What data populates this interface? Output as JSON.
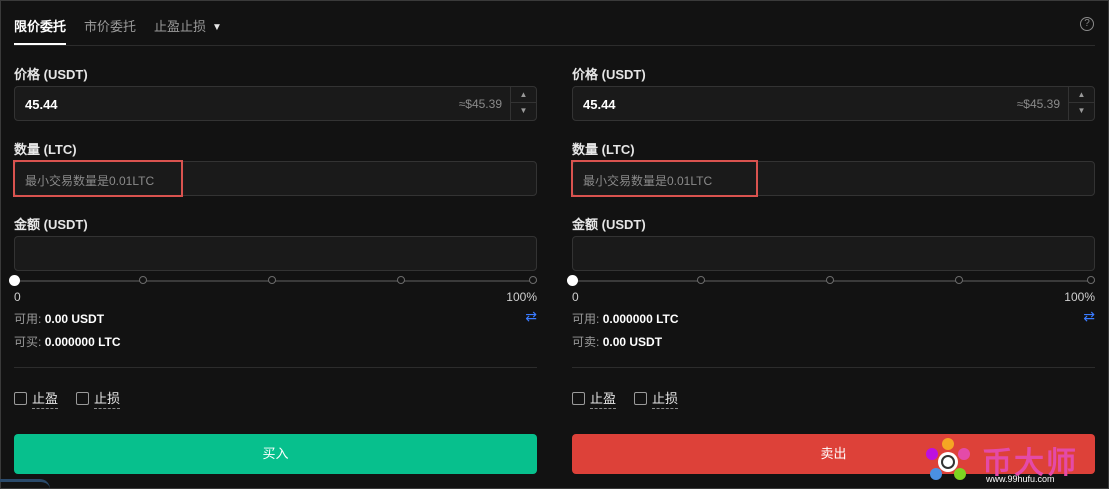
{
  "tabs": [
    {
      "label": "限价委托",
      "active": true
    },
    {
      "label": "市价委托",
      "active": false
    },
    {
      "label": "止盈止损",
      "active": false
    }
  ],
  "help_icon": "?",
  "buy": {
    "price_label": "价格 (USDT)",
    "price_value": "45.44",
    "price_approx": "≈$45.39",
    "qty_label": "数量 (LTC)",
    "qty_placeholder": "最小交易数量是0.01LTC",
    "amount_label": "金额 (USDT)",
    "amount_value": "",
    "slider_min": "0",
    "slider_max": "100%",
    "slider_value": 0,
    "available_label": "可用:",
    "available_value": "0.00 USDT",
    "can_label": "可买:",
    "can_value": "0.000000 LTC",
    "take_profit": "止盈",
    "stop_loss": "止损",
    "action_label": "买入",
    "action_color": "#07c08d"
  },
  "sell": {
    "price_label": "价格 (USDT)",
    "price_value": "45.44",
    "price_approx": "≈$45.39",
    "qty_label": "数量 (LTC)",
    "qty_placeholder": "最小交易数量是0.01LTC",
    "amount_label": "金额 (USDT)",
    "amount_value": "",
    "slider_min": "0",
    "slider_max": "100%",
    "slider_value": 0,
    "available_label": "可用:",
    "available_value": "0.000000 LTC",
    "can_label": "可卖:",
    "can_value": "0.00 USDT",
    "take_profit": "止盈",
    "stop_loss": "止损",
    "action_label": "卖出",
    "action_color": "#dd4139"
  },
  "watermark": {
    "text": "币大师",
    "url": "www.99hufu.com"
  }
}
